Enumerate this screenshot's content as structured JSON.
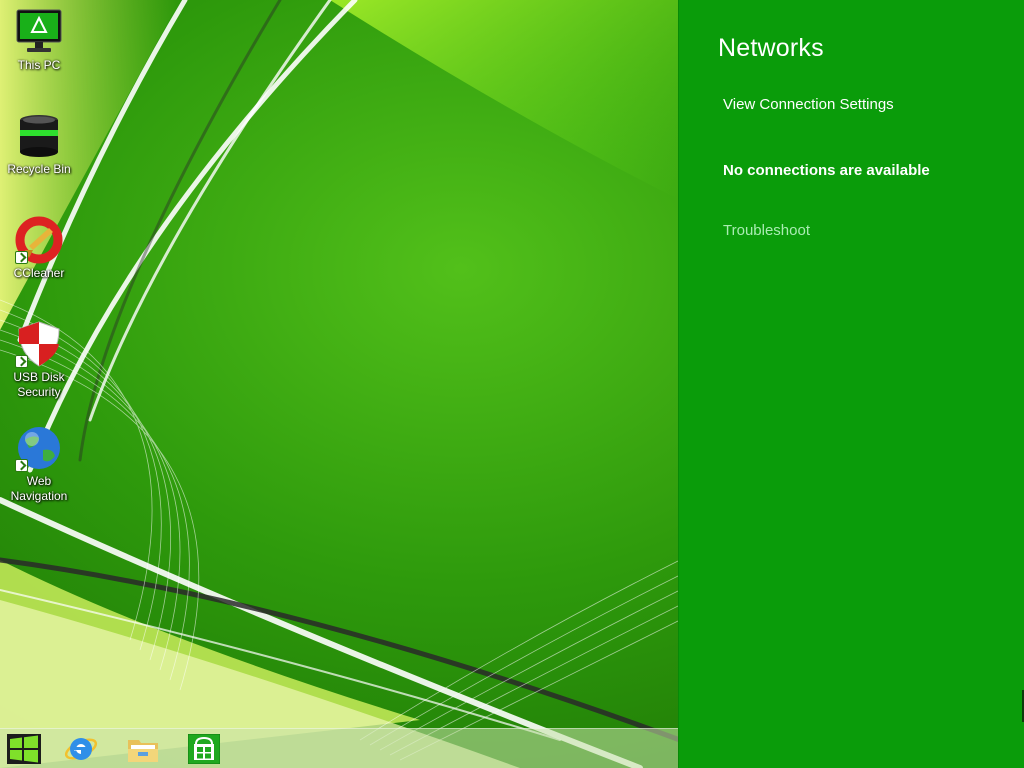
{
  "desktop": {
    "icons": [
      {
        "label": "This PC",
        "icon": "monitor-icon"
      },
      {
        "label": "Recycle Bin",
        "icon": "recycle-bin-icon"
      },
      {
        "label": "CCleaner",
        "icon": "ccleaner-icon"
      },
      {
        "label": "USB Disk\nSecurity",
        "icon": "shield-icon"
      },
      {
        "label": "Web\nNavigation",
        "icon": "globe-icon"
      }
    ]
  },
  "taskbar": {
    "items": [
      {
        "icon": "windows-start-icon"
      },
      {
        "icon": "internet-explorer-icon"
      },
      {
        "icon": "file-explorer-icon"
      },
      {
        "icon": "store-icon"
      }
    ]
  },
  "networks_panel": {
    "title": "Networks",
    "view_connection_settings": "View Connection Settings",
    "status": "No connections are available",
    "troubleshoot": "Troubleshoot"
  },
  "colors": {
    "panel_bg": "#0a9c0a",
    "wallpaper_green": "#3aa30f",
    "troubleshoot_link": "#a9ecb2"
  }
}
